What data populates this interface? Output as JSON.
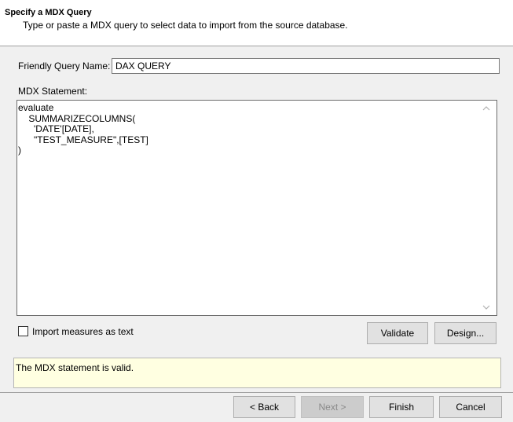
{
  "header": {
    "title": "Specify a MDX Query",
    "subtitle": "Type or paste a MDX query to select data to import from the source database."
  },
  "friendly_name": {
    "label": "Friendly Query Name:",
    "value": "DAX QUERY"
  },
  "mdx": {
    "label": "MDX Statement:",
    "text": "evaluate\n    SUMMARIZECOLUMNS(\n      'DATE'[DATE],\n      \"TEST_MEASURE\",[TEST]\n)"
  },
  "import_measures": {
    "label": "Import measures as text",
    "checked": false
  },
  "buttons": {
    "validate": "Validate",
    "design": "Design...",
    "back": "< Back",
    "next": "Next >",
    "finish": "Finish",
    "cancel": "Cancel"
  },
  "status": {
    "message": "The MDX statement is valid."
  }
}
